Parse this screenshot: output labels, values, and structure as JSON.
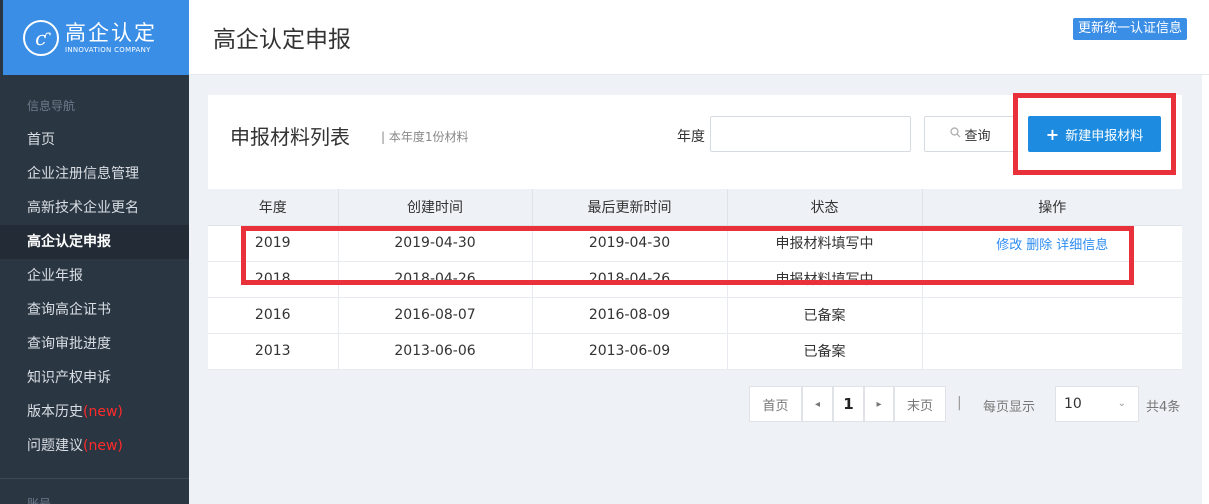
{
  "brand": {
    "logo_glyph": "ƈ",
    "title": "高企认定",
    "subtitle": "INNOVATION COMPANY"
  },
  "header": {
    "title": "高企认定申报",
    "update_button": "更新统一认证信息"
  },
  "sidebar": {
    "heading": "信息导航",
    "items": [
      {
        "label": "首页"
      },
      {
        "label": "企业注册信息管理"
      },
      {
        "label": "高新技术企业更名"
      },
      {
        "label": "高企认定申报"
      },
      {
        "label": "企业年报"
      },
      {
        "label": "查询高企证书"
      },
      {
        "label": "查询审批进度"
      },
      {
        "label": "知识产权申诉"
      },
      {
        "label": "版本历史",
        "badge": "(new)"
      },
      {
        "label": "问题建议",
        "badge": "(new)"
      }
    ],
    "heading2": "账号"
  },
  "panel": {
    "title": "申报材料列表",
    "subtitle": "| 本年度1份材料",
    "year_label": "年度",
    "year_value": "",
    "query_button": "查询",
    "new_button": "新建申报材料"
  },
  "table": {
    "columns": [
      "年度",
      "创建时间",
      "最后更新时间",
      "状态",
      "操作"
    ],
    "rows": [
      {
        "year": "2019",
        "created": "2019-04-30",
        "updated": "2019-04-30",
        "status": "申报材料填写中",
        "actions": [
          "修改",
          "删除",
          "详细信息"
        ]
      },
      {
        "year": "2018",
        "created": "2018-04-26",
        "updated": "2018-04-26",
        "status": "申报材料填写中",
        "actions": []
      },
      {
        "year": "2016",
        "created": "2016-08-07",
        "updated": "2016-08-09",
        "status": "已备案",
        "actions": []
      },
      {
        "year": "2013",
        "created": "2013-06-06",
        "updated": "2013-06-09",
        "status": "已备案",
        "actions": []
      }
    ]
  },
  "pagination": {
    "first": "首页",
    "prev": "◂",
    "current": "1",
    "next": "▸",
    "last": "末页",
    "separator": "|",
    "per_page_label": "每页显示",
    "per_page_value": "10",
    "caret": "⌄",
    "total": "共4条"
  },
  "colors": {
    "accent": "#3a8ee6",
    "sidebar_bg": "#2b3643",
    "highlight": "#e8313a",
    "link": "#2d8cf0"
  }
}
